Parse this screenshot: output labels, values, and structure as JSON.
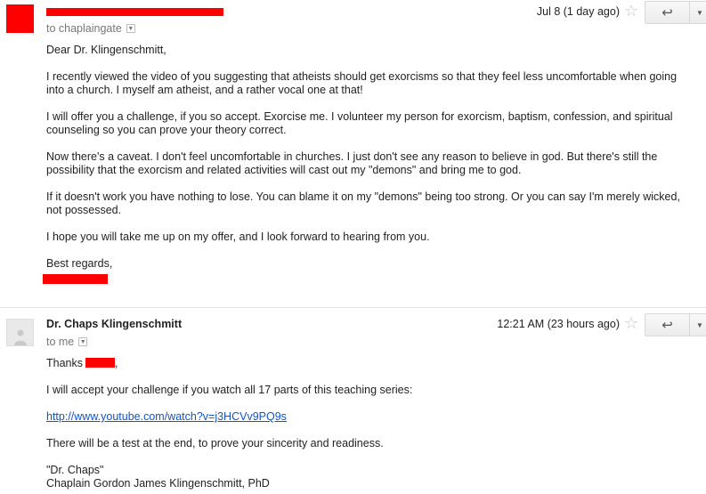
{
  "message1": {
    "to_label": "to chaplaingate",
    "date": "Jul 8 (1 day ago)",
    "greeting": "Dear Dr. Klingenschmitt,",
    "paragraphs": [
      "I recently viewed the video of you suggesting that atheists should get exorcisms so that they feel less uncomfortable when going into a church. I myself am atheist, and a rather vocal one at that!",
      "I will offer you a challenge, if you so accept. Exorcise me. I volunteer my person for exorcism, baptism, confession, and spiritual counseling so you can prove your theory correct.",
      "Now there's a caveat. I don't feel uncomfortable in churches. I just don't see any reason to believe in god. But there's still the possibility that the exorcism and related activities will cast out my \"demons\" and bring me to god.",
      "If it doesn't work you have nothing to lose. You can blame it on my \"demons\" being too strong. Or you can say I'm merely wicked, not possessed.",
      "I hope you will take me up on my offer, and I look forward to hearing from you."
    ],
    "closing": "Best regards,"
  },
  "message2": {
    "sender": "Dr. Chaps Klingenschmitt",
    "to_label": "to me",
    "date": "12:21 AM (23 hours ago)",
    "thanks_prefix": "Thanks",
    "thanks_suffix": ",",
    "line1": "I will accept your challenge if you watch all 17 parts of this teaching series:",
    "link": "http://www.youtube.com/watch?v=j3HCVv9PQ9s",
    "line2": "There will be a test at the end, to prove your sincerity and readiness.",
    "sig1": "\"Dr. Chaps\"",
    "sig2": "Chaplain Gordon James Klingenschmitt, PhD"
  },
  "icons": {
    "star": "star-outline-icon",
    "reply": "reply-arrow-icon",
    "more": "chevron-down-icon",
    "avatar": "person-silhouette-icon"
  },
  "colors": {
    "redaction": "#ff0000",
    "link": "#1155cc"
  }
}
